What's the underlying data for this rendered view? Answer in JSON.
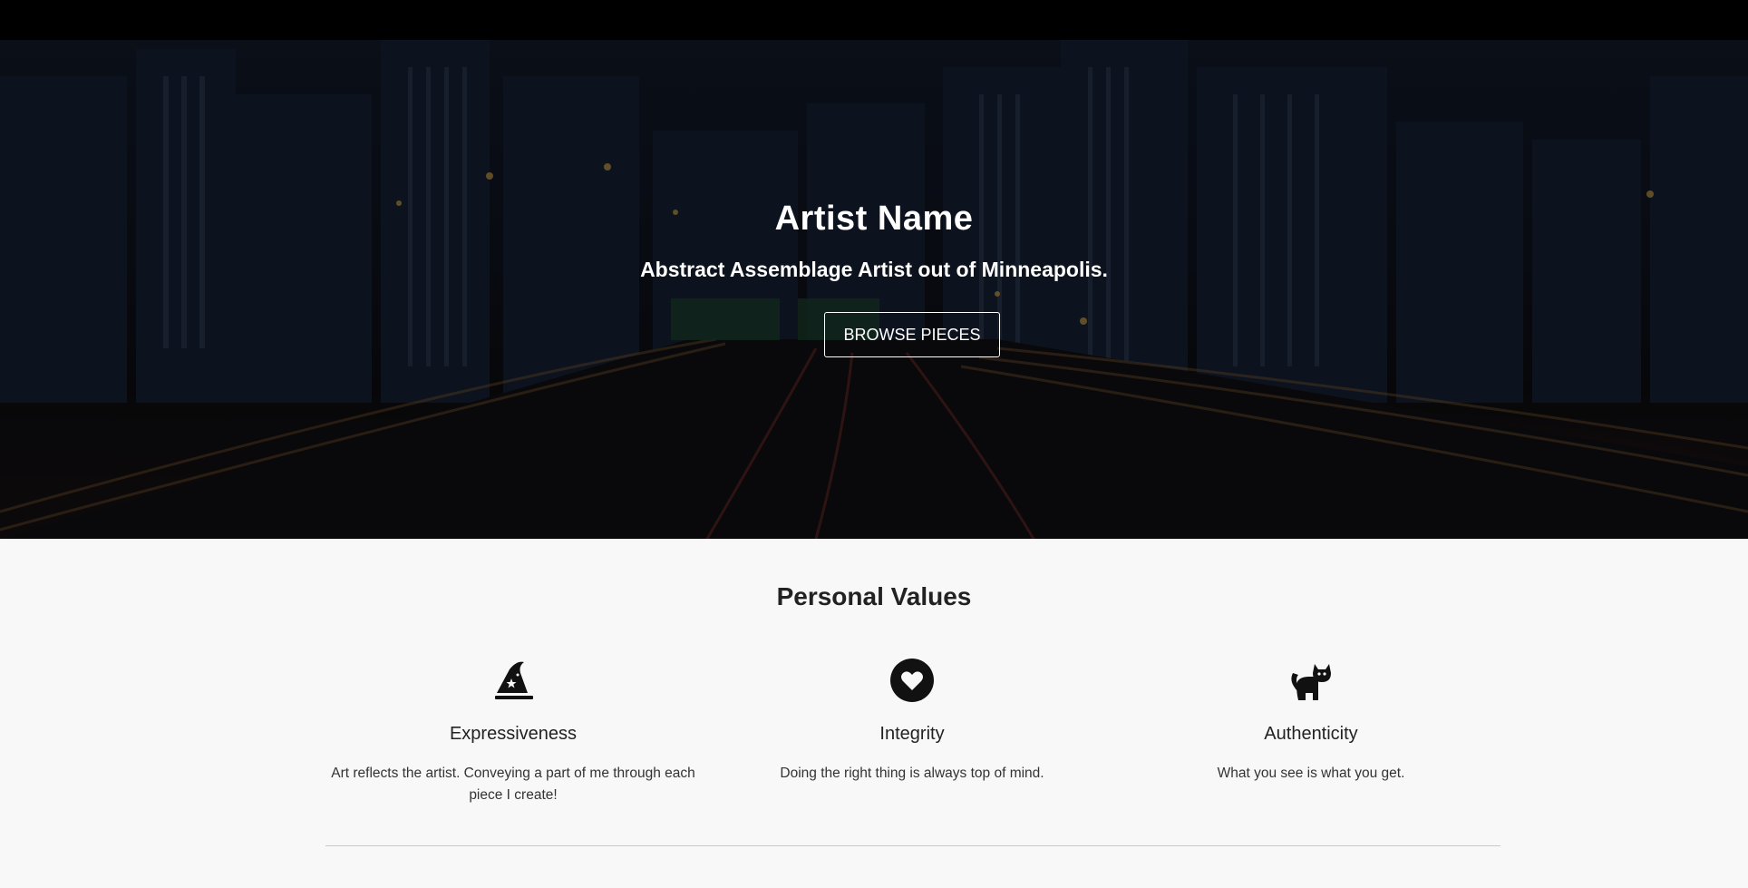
{
  "hero": {
    "title": "Artist Name",
    "subtitle": "Abstract Assemblage Artist out of Minneapolis.",
    "button_label": "BROWSE PIECES"
  },
  "values": {
    "heading": "Personal Values",
    "items": [
      {
        "icon": "wizard-hat-icon",
        "title": "Expressiveness",
        "description": "Art reflects the artist. Conveying a part of me through each piece I create!"
      },
      {
        "icon": "heart-circle-icon",
        "title": "Integrity",
        "description": "Doing the right thing is always top of mind."
      },
      {
        "icon": "cat-icon",
        "title": "Authenticity",
        "description": "What you see is what you get."
      }
    ]
  },
  "colors": {
    "topbar": "#000000",
    "hero_overlay": "#0b0f18",
    "section_background": "#f8f8f8",
    "text_dark": "#222222",
    "hero_text": "#ffffff"
  }
}
